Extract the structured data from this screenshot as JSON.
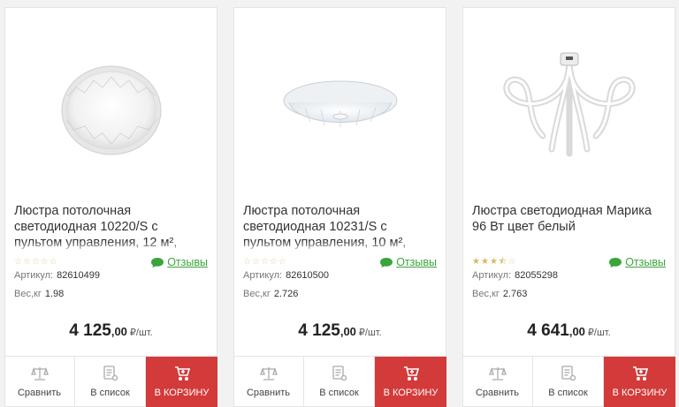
{
  "products": [
    {
      "title": "Люстра потолочная светодиодная 10220/S с пультом управления, 12 м²,",
      "rating": 0,
      "reviews_label": "Отзывы",
      "article_label": "Артикул:",
      "article": "82610499",
      "weight_label": "Вес,кг",
      "weight": "1.98",
      "price_int": "4 125",
      "price_dec": ",00",
      "price_unit": "₽/шт.",
      "compare_label": "Сравнить",
      "list_label": "В список",
      "cart_label": "В КОРЗИНУ",
      "image_icon": "round-ceiling-lamp-icon"
    },
    {
      "title": "Люстра потолочная светодиодная 10231/S с пультом управления, 10 м²,",
      "rating": 0,
      "reviews_label": "Отзывы",
      "article_label": "Артикул:",
      "article": "82610500",
      "weight_label": "Вес,кг",
      "weight": "2.726",
      "price_int": "4 125",
      "price_dec": ",00",
      "price_unit": "₽/шт.",
      "compare_label": "Сравнить",
      "list_label": "В список",
      "cart_label": "В КОРЗИНУ",
      "image_icon": "flat-ceiling-lamp-icon"
    },
    {
      "title": "Люстра светодиодная Марика 96 Вт цвет белый",
      "rating": 3.5,
      "reviews_label": "Отзывы",
      "article_label": "Артикул:",
      "article": "82055298",
      "weight_label": "Вес,кг",
      "weight": "2.763",
      "price_int": "4 641",
      "price_dec": ",00",
      "price_unit": "₽/шт.",
      "compare_label": "Сравнить",
      "list_label": "В список",
      "cart_label": "В КОРЗИНУ",
      "image_icon": "spiral-chandelier-icon"
    }
  ],
  "colors": {
    "cart_button": "#d33a3a",
    "reviews_link": "#3aa53a",
    "stars": "#d8b760"
  }
}
